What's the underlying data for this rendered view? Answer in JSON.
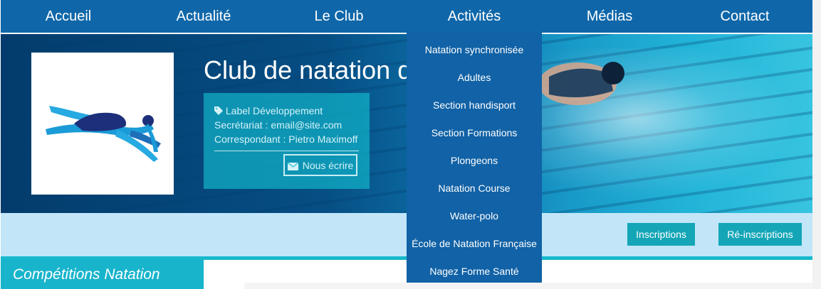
{
  "nav": {
    "items": [
      {
        "label": "Accueil"
      },
      {
        "label": "Actualité"
      },
      {
        "label": "Le Club"
      },
      {
        "label": "Activités"
      },
      {
        "label": "Médias"
      },
      {
        "label": "Contact"
      }
    ]
  },
  "hero": {
    "title": "Club de natation de"
  },
  "info_card": {
    "label": "Label Développement",
    "secretariat": "Secrétariat : email@site.com",
    "correspondant": "Correspondant : Pietro Maximoff",
    "write_button": "Nous écrire"
  },
  "actions": {
    "inscriptions": "Inscriptions",
    "reinscriptions": "Ré-inscriptions"
  },
  "sidebar": {
    "competitions_title": "Compétitions Natation"
  },
  "dropdown": {
    "items": [
      {
        "label": "Natation synchronisée"
      },
      {
        "label": "Adultes"
      },
      {
        "label": "Section handisport"
      },
      {
        "label": "Section Formations"
      },
      {
        "label": "Plongeons"
      },
      {
        "label": "Natation Course"
      },
      {
        "label": "Water-polo"
      },
      {
        "label": "École de Natation Française"
      },
      {
        "label": "Nagez Forme Santé"
      }
    ]
  },
  "colors": {
    "nav_bg": "#0f67a9",
    "dropdown_bg": "#1162a6",
    "accent_teal": "#14a6b7",
    "action_bar_bg": "#c2e6f8"
  },
  "icons": {
    "label": "tag-icon",
    "write": "envelope-icon"
  }
}
